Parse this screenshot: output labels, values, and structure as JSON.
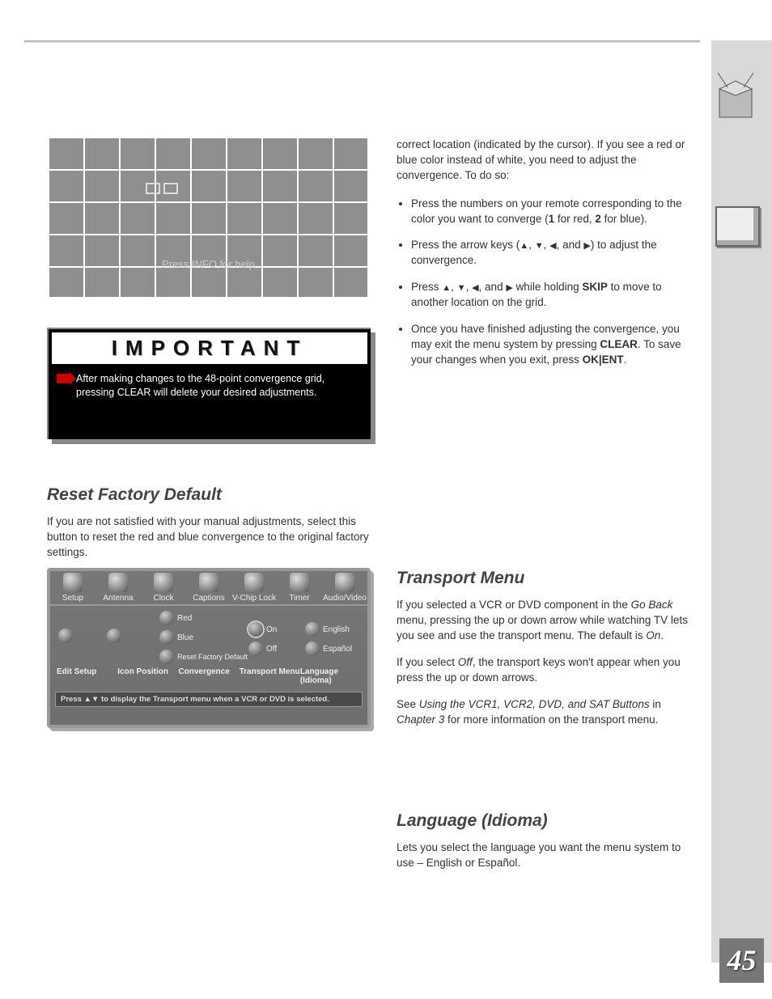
{
  "page_number": "45",
  "convergence": {
    "caption": "Press INFO for help",
    "para1": "correct location (indicated by the cursor). If you see a red or blue color instead of white, you need to adjust the convergence. To do so:",
    "bullet1_a": "Press the numbers on your remote corresponding to the color you want to converge (",
    "bullet1_b": " for red, ",
    "bullet1_c": " for blue).",
    "num1": "1",
    "num2": "2",
    "bullet2_a": "Press the arrow keys (",
    "bullet2_b": ", ",
    "bullet2_c": ", and ",
    "bullet2_d": ") to adjust the convergence.",
    "bullet3_a": "Press ",
    "bullet3_b": ", and ",
    "bullet3_c": " while holding ",
    "bullet3_d": "to move to another location on the grid.",
    "skip_label": "SKIP",
    "bullet4_a": "Once you have finished adjusting the convergence, you may exit the menu system by pressing ",
    "bullet4_b": ". To save your changes when you exit, press ",
    "clear_label": "CLEAR",
    "ok_label": "OK|ENT"
  },
  "important": {
    "heading": "IMPORTANT",
    "body": "After making changes to the 48-point convergence grid, pressing CLEAR will delete your desired adjustments."
  },
  "reset": {
    "heading": "Reset Factory Default",
    "body": "If you are not satisfied with your manual adjustments, select this button to reset the red and blue convergence to the original factory settings."
  },
  "transport": {
    "heading": "Transport Menu",
    "para1_a": "If you selected a VCR or DVD component in the ",
    "para1_b": " menu, pressing the up or down arrow while watching TV lets you see and use the transport menu. The default is ",
    "go_back": "Go Back",
    "on_label": "On",
    "para2_a": "If you select ",
    "off_label": "Off",
    "para2_b": ", the transport keys won't appear when you press the up or down arrows.",
    "para3_a": "See ",
    "para3_b": " in ",
    "btn_label": "Using the VCR1, VCR2, DVD, and SAT Buttons",
    "chapter": "Chapter 3",
    "para3_c": " for more information on the transport menu."
  },
  "language": {
    "heading": "Language (Idioma)",
    "body": "Lets you select the language you want the menu system to use – English or Español."
  },
  "setup_menu": {
    "tabs": [
      "Setup",
      "Antenna",
      "Clock",
      "Captions",
      "V-Chip Lock",
      "Timer",
      "Audio/Video"
    ],
    "convergence_opts": [
      "Red",
      "Blue",
      "Reset Factory Default"
    ],
    "bottom_labels": [
      "Edit Setup",
      "Icon Position",
      "Convergence",
      "Transport Menu",
      "Language (Idioma)"
    ],
    "transport_opts": [
      "On",
      "Off"
    ],
    "lang_opts": [
      "English",
      "Español"
    ],
    "status": "Press ▲▼ to display the Transport menu when a VCR or DVD is selected."
  }
}
